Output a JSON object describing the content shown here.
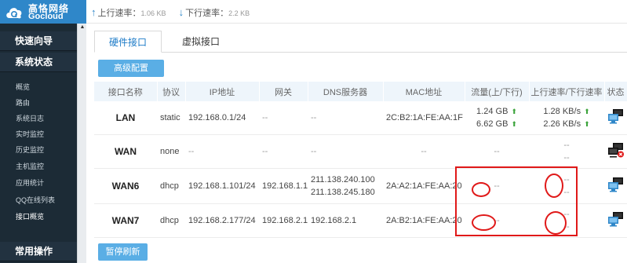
{
  "logo": {
    "name_cn": "高恪网络",
    "name_en": "Gocloud"
  },
  "header": {
    "upload_label": "上行速率：",
    "upload_value": "1.06 KB",
    "download_label": "下行速率：",
    "download_value": "2.2 KB"
  },
  "sidebar": {
    "quick_guide": "快速向导",
    "system_status": "系统状态",
    "items": [
      {
        "label": "概览"
      },
      {
        "label": "路由"
      },
      {
        "label": "系统日志"
      },
      {
        "label": "实时监控"
      },
      {
        "label": "历史监控"
      },
      {
        "label": "主机监控"
      },
      {
        "label": "应用统计"
      },
      {
        "label": "QQ在线列表"
      },
      {
        "label": "接口概览"
      }
    ],
    "common_ops": "常用操作"
  },
  "tabs": [
    {
      "label": "硬件接口"
    },
    {
      "label": "虚拟接口"
    }
  ],
  "buttons": {
    "advanced": "高级配置",
    "pause_refresh": "暂停刷新"
  },
  "table": {
    "headers": [
      "接口名称",
      "协议",
      "IP地址",
      "网关",
      "DNS服务器",
      "MAC地址",
      "流量(上/下行)",
      "上行速率/下行速率",
      "状态"
    ],
    "rows": [
      {
        "name": "LAN",
        "protocol": "static",
        "ip": "192.168.0.1/24",
        "gateway": "--",
        "dns1": "--",
        "dns2": "",
        "mac": "2C:B2:1A:FE:AA:1F",
        "traffic_up": "1.24 GB",
        "traffic_down": "6.62 GB",
        "rate_up": "1.28 KB/s",
        "rate_down": "2.26 KB/s",
        "status": "connected"
      },
      {
        "name": "WAN",
        "protocol": "none",
        "ip": "--",
        "gateway": "--",
        "dns1": "--",
        "dns2": "",
        "mac": "--",
        "traffic_up": "--",
        "traffic_down": "",
        "rate_up": "--",
        "rate_down": "--",
        "status": "disconnected"
      },
      {
        "name": "WAN6",
        "protocol": "dhcp",
        "ip": "192.168.1.101/24",
        "gateway": "192.168.1.1",
        "dns1": "211.138.240.100",
        "dns2": "211.138.245.180",
        "mac": "2A:A2:1A:FE:AA:20",
        "traffic_up": "--",
        "traffic_down": "",
        "rate_up": "--",
        "rate_down": "--",
        "status": "connected"
      },
      {
        "name": "WAN7",
        "protocol": "dhcp",
        "ip": "192.168.2.177/24",
        "gateway": "192.168.2.1",
        "dns1": "192.168.2.1",
        "dns2": "",
        "mac": "2A:B2:1A:FE:AA:20",
        "traffic_up": "--",
        "traffic_down": "",
        "rate_up": "--",
        "rate_down": "--",
        "status": "connected"
      }
    ]
  },
  "colors": {
    "brand": "#2f87c9",
    "sidebar_bg": "#1c2b36",
    "button": "#5aaee5",
    "annotation": "#e01919",
    "arrow_up": "#3aa33a"
  }
}
